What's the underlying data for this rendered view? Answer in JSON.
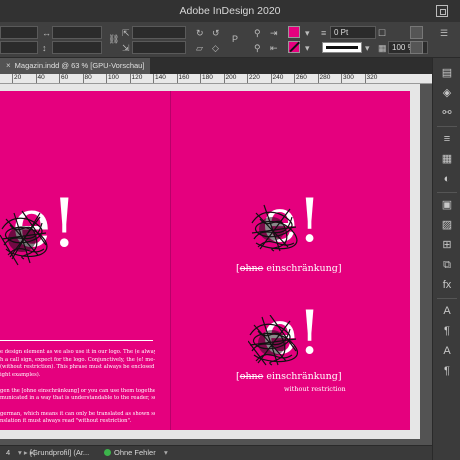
{
  "window": {
    "title": "Adobe InDesign 2020"
  },
  "control": {
    "stroke_weight": "0 Pt",
    "zoom": "100 %",
    "colors": {
      "fill": "#e5007e",
      "stroke": "#e5007e"
    }
  },
  "tab": {
    "label": "Magazin.indd @ 63 % [GPU-Vorschau]",
    "close_glyph": "×"
  },
  "ruler": {
    "labels": [
      "20",
      "40",
      "60",
      "80",
      "100",
      "120",
      "140",
      "160",
      "180",
      "200",
      "220",
      "240",
      "260",
      "280",
      "300",
      "320"
    ]
  },
  "page": {
    "background": "#e5007e",
    "left_mark": "e!",
    "right_mark_top": "e!",
    "right_mark_bottom": "e!",
    "bracket_open": "[",
    "bracket_strike_top": "ohne",
    "bracket_strike_bottom": "ohne",
    "bracket_rest": " einschränkung]",
    "sub_caption": "without restriction",
    "body_lines": [
      "e design element as we also use it in our logo. The (e always",
      "h a call sign, expect for the logo. Conjunctively, the (e! me-",
      "(without restriction). This phrase must always be enclosed",
      "ight examples).",
      "",
      "gen the [ohne einschränkung] or you can use them together",
      "municated in a way that is understandable to the reader, so",
      "",
      "german, which means it can only be translated as shown so",
      "nslation it must always read \"without restriction\"."
    ]
  },
  "status": {
    "page_number": "4",
    "master": "[Grundprofil] (Ar...",
    "preflight": "Ohne Fehler",
    "preflight_color": "#3cb44b"
  }
}
